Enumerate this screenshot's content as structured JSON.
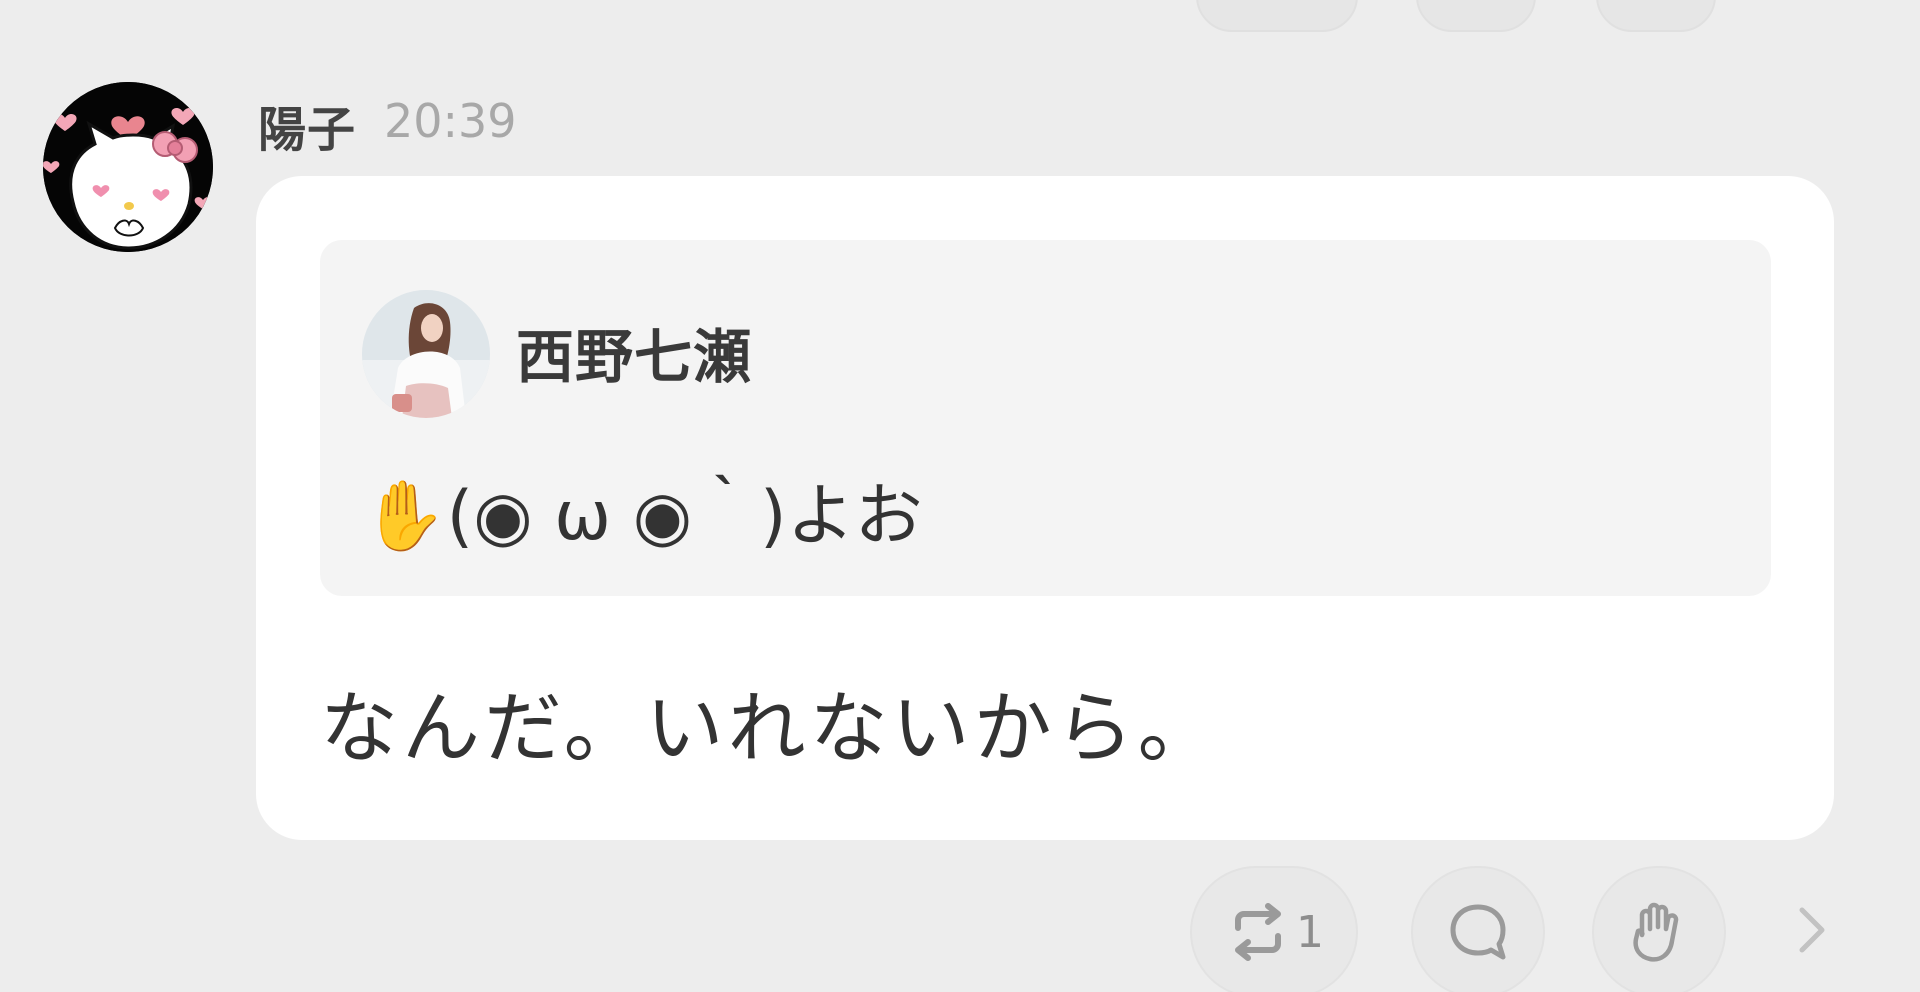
{
  "post": {
    "author_name": "陽子",
    "timestamp": "20:39",
    "avatar_icon": "hello-kitty-avatar",
    "quote": {
      "author_name": "西野七瀬",
      "avatar_icon": "profile-photo",
      "text": "✋(◉ ω ◉｀)よお"
    },
    "message_text": "なんだ。いれないから。"
  },
  "actions": {
    "repost_icon": "repost-icon",
    "repost_count": "1",
    "reply_icon": "speech-bubble-icon",
    "clap_icon": "clap-icon",
    "more_icon": "chevron-right-icon"
  },
  "colors": {
    "background": "#ededed",
    "bubble": "#ffffff",
    "quote_background": "#f4f4f4",
    "timestamp": "#a8a8a8",
    "icon": "#9a9a9a"
  }
}
